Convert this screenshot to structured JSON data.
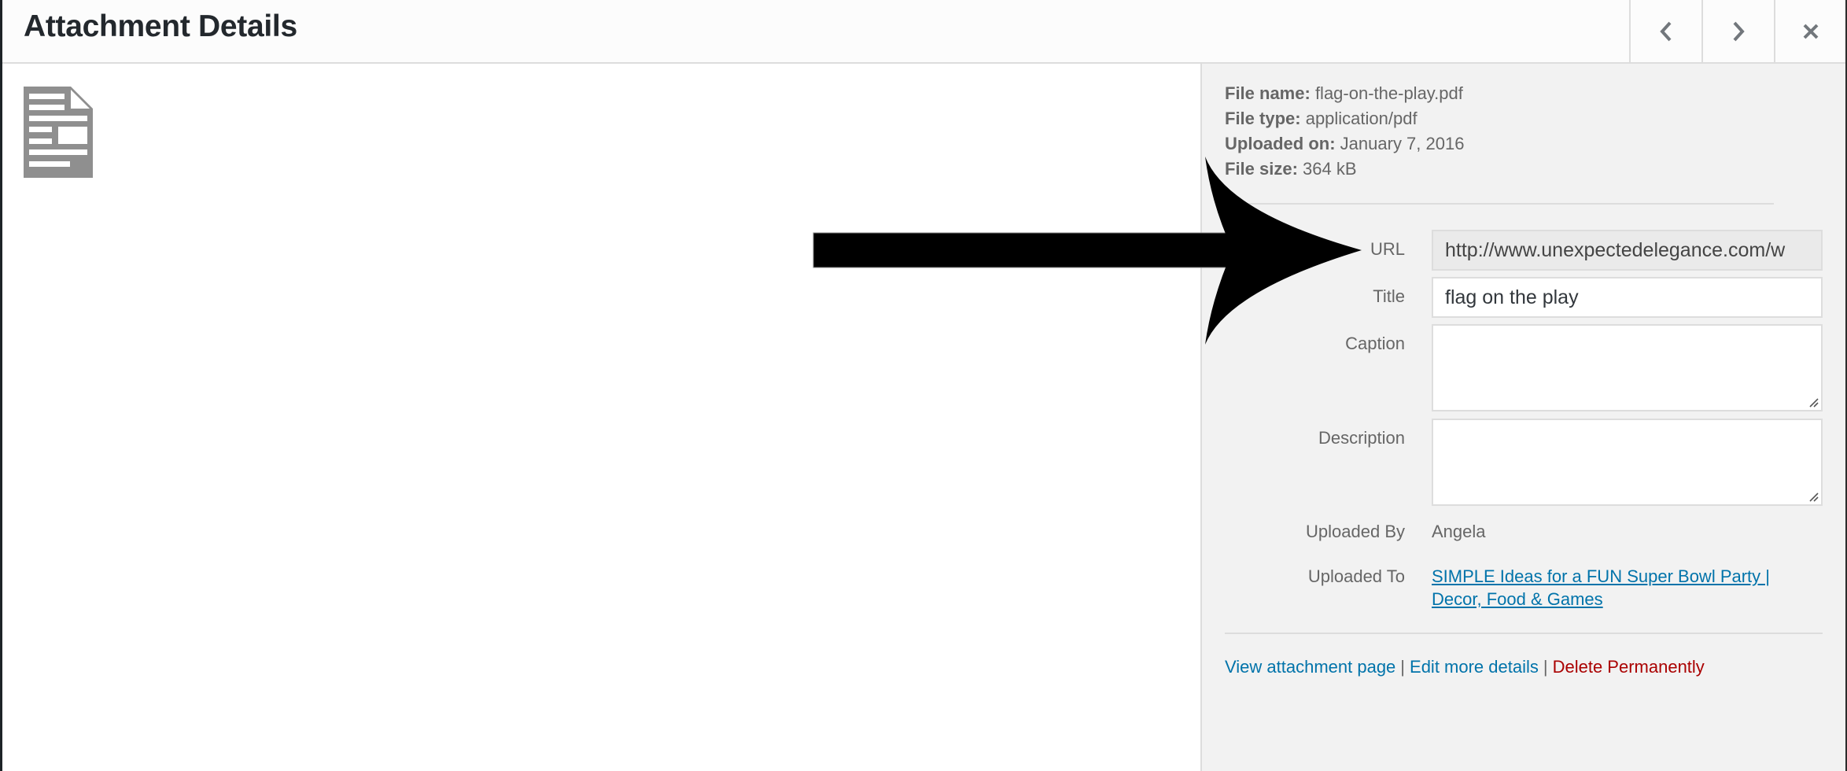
{
  "header": {
    "title": "Attachment Details",
    "prev_icon": "chevron-left-icon",
    "next_icon": "chevron-right-icon",
    "close_icon": "close-icon"
  },
  "preview": {
    "icon": "document-icon"
  },
  "file_info": {
    "file_name_label": "File name:",
    "file_name": "flag-on-the-play.pdf",
    "file_type_label": "File type:",
    "file_type": "application/pdf",
    "uploaded_on_label": "Uploaded on:",
    "uploaded_on": "January 7, 2016",
    "file_size_label": "File size:",
    "file_size": "364 kB"
  },
  "fields": {
    "url_label": "URL",
    "url_value": "http://www.unexpectedelegance.com/w",
    "title_label": "Title",
    "title_value": "flag on the play",
    "caption_label": "Caption",
    "caption_value": "",
    "description_label": "Description",
    "description_value": "",
    "uploaded_by_label": "Uploaded By",
    "uploaded_by": "Angela",
    "uploaded_to_label": "Uploaded To",
    "uploaded_to": "SIMPLE Ideas for a FUN Super Bowl Party | Decor, Food & Games"
  },
  "actions": {
    "view": "View attachment page",
    "edit": "Edit more details",
    "delete": "Delete Permanently",
    "separator": "|"
  },
  "annotation": {
    "icon": "arrow-right-icon",
    "points_to": "URL"
  },
  "colors": {
    "link": "#0073aa",
    "danger": "#aa0000",
    "sidebar_bg": "#f2f2f2"
  }
}
